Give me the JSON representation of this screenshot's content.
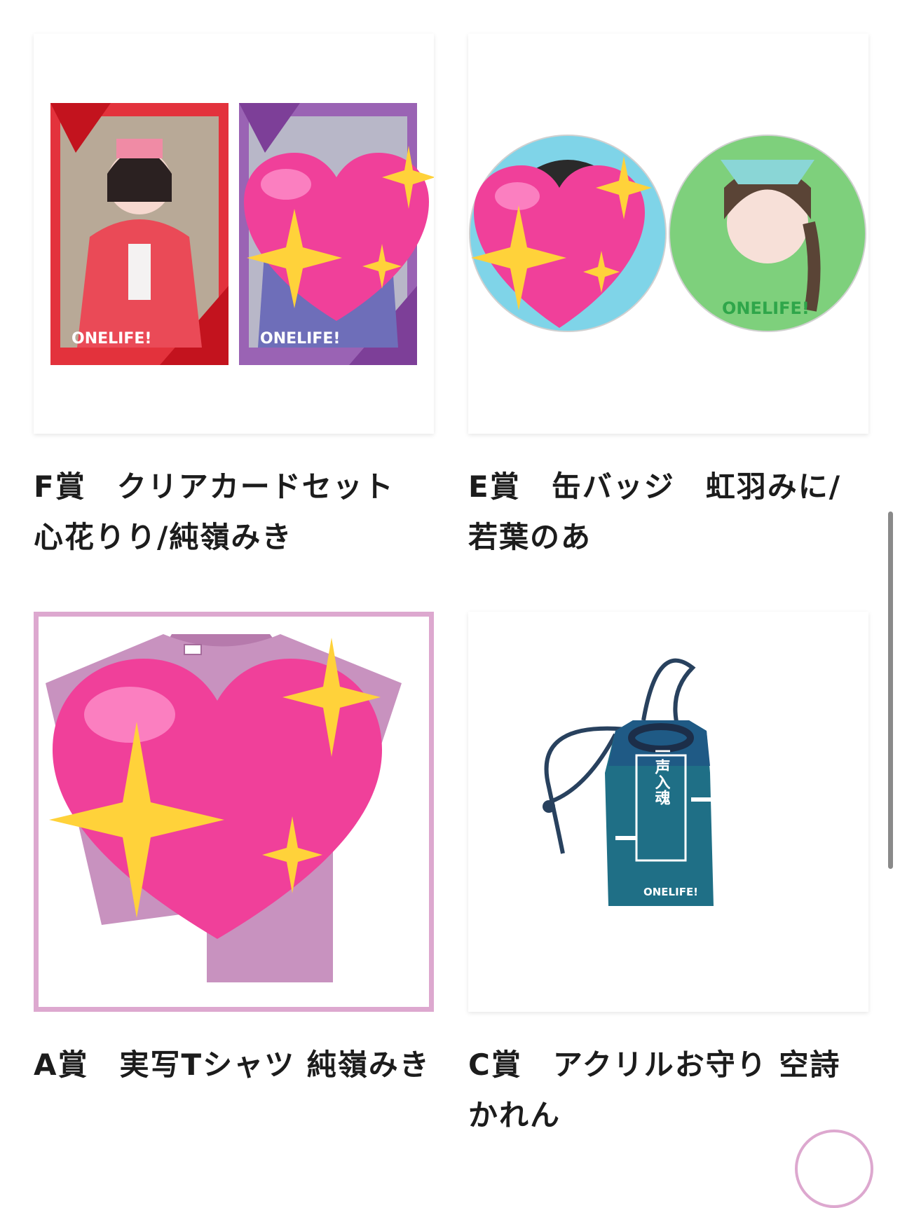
{
  "products": [
    {
      "id": "f",
      "title_line1": "F賞　クリアカードセット",
      "title_line2": "心花りり/純嶺みき",
      "logo_text": "ONELIFE!"
    },
    {
      "id": "e",
      "title_line1": "E賞　缶バッジ　虹羽みに/",
      "title_line2": "若葉のあ",
      "logo_text": "ONELIFE!"
    },
    {
      "id": "a",
      "title_line1": "A賞　実写Tシャツ 純嶺みき",
      "title_line2": ""
    },
    {
      "id": "c",
      "title_line1": "C賞　アクリルお守り 空詩",
      "title_line2": "かれん",
      "charm_text": "一声入魂",
      "charm_logo": "ONELIFE!"
    }
  ],
  "colors": {
    "selected_border": "#dda8cf",
    "heart": "#f0409a",
    "sparkle": "#ffd23a",
    "shirt": "#c892bf",
    "charm": "#1f6f86"
  }
}
